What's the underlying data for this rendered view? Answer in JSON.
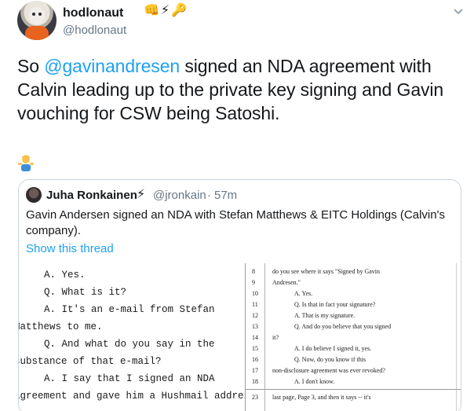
{
  "tweet": {
    "display_name": "hodlonaut",
    "badges": [
      {
        "icon": "fist-emoji-icon",
        "glyph": "👊"
      },
      {
        "icon": "lightning-icon",
        "glyph": "⚡"
      },
      {
        "icon": "key-icon",
        "glyph": "🔑"
      }
    ],
    "handle": "@hodlonaut",
    "text_prefix": "So ",
    "mention": "@gavinandresen",
    "text_suffix": " signed an NDA agreement with Calvin leading up to the private key signing and Gavin vouching for CSW being Satoshi.",
    "colors": {
      "link": "#1da1f2",
      "muted": "#657786",
      "text": "#14171a",
      "border": "#ccd6dd"
    }
  },
  "quote": {
    "display_name": "Juha Ronkainen",
    "bolt_glyph": "⚡",
    "handle": "@jronkain",
    "separator": "·",
    "time": "57m",
    "text": "Gavin Andersen signed an NDA with Stefan Matthews & EITC Holdings (Calvin's company).",
    "show_thread": "Show this thread"
  },
  "doc_left": {
    "lines": [
      "A.      Yes.",
      "Q.      What is it?",
      "A.      It's an e-mail from Stefan",
      "Matthews to me.",
      "Q.      And what do you say in the",
      "substance of that e-mail?",
      "A.      I say that I signed an NDA",
      "agreement and gave him a Hushmail address"
    ]
  },
  "doc_right": {
    "numbers": [
      "8",
      "9",
      "10",
      "11",
      "12",
      "13",
      "14",
      "15",
      "16",
      "17",
      "18",
      "23"
    ],
    "lines": [
      "do you see where it says \"Signed by Gavin",
      "Andresen.\"",
      "A.      Yes.",
      "Q.      Is that in fact your signature?",
      "A.      That is my signature.",
      "Q.      And do you believe that you signed",
      "it?",
      "A.      I do believe I signed it, yes.",
      "Q.      Now, do you know if this",
      "non-disclosure agreement was ever revoked?",
      "A.      I don't know.",
      "last page, Page 3, and then it says -- it's"
    ]
  }
}
